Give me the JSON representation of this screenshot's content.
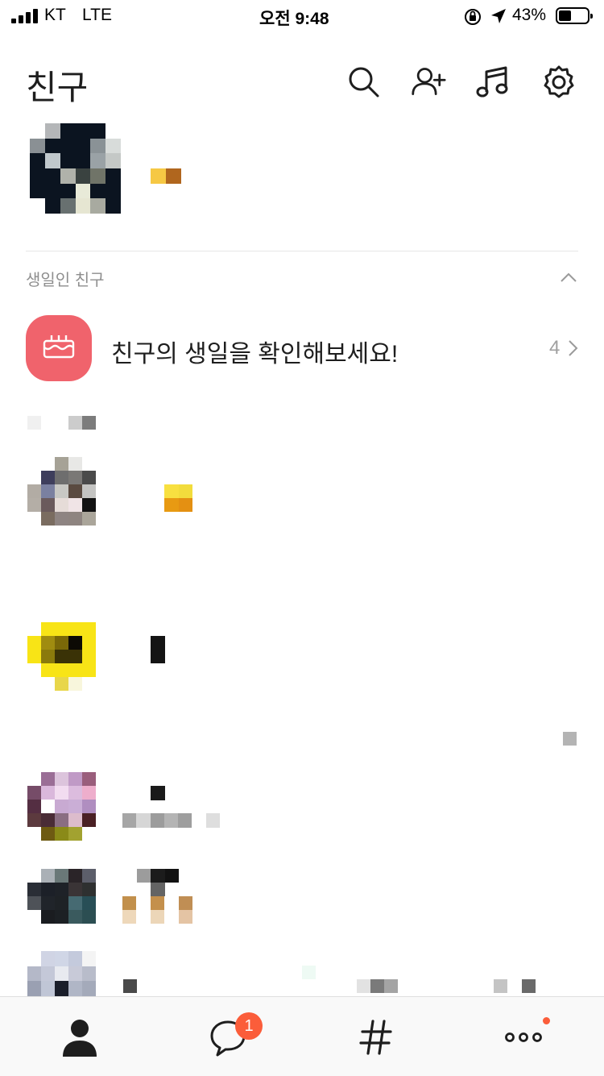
{
  "status_bar": {
    "carrier": "KT",
    "network": "LTE",
    "time": "오전 9:48",
    "battery_percent": "43%",
    "battery_level": 0.43
  },
  "header": {
    "title": "친구",
    "icons": [
      "search-icon",
      "add-friend-icon",
      "music-icon",
      "settings-icon"
    ]
  },
  "birthday_section": {
    "label": "생일인 친구",
    "message": "친구의 생일을 확인해보세요!",
    "count": "4"
  },
  "tab_bar": {
    "items": [
      "friends-tab",
      "chats-tab",
      "hashtag-tab",
      "more-tab"
    ],
    "chat_badge": "1"
  },
  "colors": {
    "accent": "#fb5d3a",
    "birthday_icon_bg": "#f0636c",
    "text_primary": "#1e1e1e",
    "text_secondary": "#8e8e8e"
  }
}
